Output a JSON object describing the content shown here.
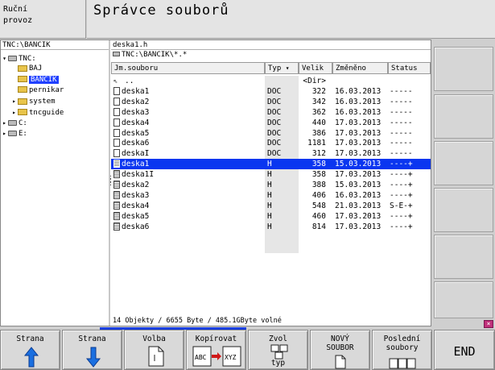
{
  "header": {
    "mode_line1": "Ruční",
    "mode_line2": "provoz",
    "title": "Správce souborů"
  },
  "tree": {
    "path": "TNC:\\BANCIK",
    "items": [
      {
        "label": "TNC:",
        "toggle": "▾",
        "icon": "drive-icon",
        "indent": 0
      },
      {
        "label": "BAJ",
        "toggle": "",
        "icon": "folder-icon",
        "indent": 1
      },
      {
        "label": "BANCIK",
        "toggle": "",
        "icon": "folder-icon",
        "indent": 1,
        "selected": true
      },
      {
        "label": "pernikar",
        "toggle": "",
        "icon": "folder-icon",
        "indent": 1
      },
      {
        "label": "system",
        "toggle": "▸",
        "icon": "folder-icon",
        "indent": 1
      },
      {
        "label": "tncguide",
        "toggle": "▸",
        "icon": "folder-icon",
        "indent": 1
      },
      {
        "label": "C:",
        "toggle": "▸",
        "icon": "drive-icon",
        "indent": 0
      },
      {
        "label": "E:",
        "toggle": "▸",
        "icon": "drive-icon",
        "indent": 0
      }
    ]
  },
  "files": {
    "selected_file": "deska1.h",
    "filter_path": "TNC:\\BANCIK\\*.*",
    "columns": {
      "name": "Jm.souboru",
      "type": "Typ",
      "type_arrow": "▾",
      "size": "Velik",
      "date": "Změněno",
      "status": "Status"
    },
    "rows": [
      {
        "name": "..",
        "type": "",
        "size": "<Dir>",
        "date": "",
        "status": "",
        "icon": "up-dir"
      },
      {
        "name": "deska1",
        "type": "DOC",
        "size": "322",
        "date": "16.03.2013",
        "status": "-----",
        "icon": "file"
      },
      {
        "name": "deska2",
        "type": "DOC",
        "size": "342",
        "date": "16.03.2013",
        "status": "-----",
        "icon": "file"
      },
      {
        "name": "deska3",
        "type": "DOC",
        "size": "362",
        "date": "16.03.2013",
        "status": "-----",
        "icon": "file"
      },
      {
        "name": "deska4",
        "type": "DOC",
        "size": "440",
        "date": "17.03.2013",
        "status": "-----",
        "icon": "file"
      },
      {
        "name": "deska5",
        "type": "DOC",
        "size": "386",
        "date": "17.03.2013",
        "status": "-----",
        "icon": "file"
      },
      {
        "name": "deska6",
        "type": "DOC",
        "size": "1181",
        "date": "17.03.2013",
        "status": "-----",
        "icon": "file"
      },
      {
        "name": "deskaI",
        "type": "DOC",
        "size": "312",
        "date": "17.03.2013",
        "status": "-----",
        "icon": "file"
      },
      {
        "name": "deska1",
        "type": "H",
        "size": "358",
        "date": "15.03.2013",
        "status": "----+",
        "icon": "hfile",
        "selected": true
      },
      {
        "name": "deska1I",
        "type": "H",
        "size": "358",
        "date": "17.03.2013",
        "status": "----+",
        "icon": "hfile"
      },
      {
        "name": "deska2",
        "type": "H",
        "size": "388",
        "date": "15.03.2013",
        "status": "----+",
        "icon": "hfile"
      },
      {
        "name": "deska3",
        "type": "H",
        "size": "406",
        "date": "16.03.2013",
        "status": "----+",
        "icon": "hfile"
      },
      {
        "name": "deska4",
        "type": "H",
        "size": "548",
        "date": "21.03.2013",
        "status": "S-E-+",
        "icon": "hfile"
      },
      {
        "name": "deska5",
        "type": "H",
        "size": "460",
        "date": "17.03.2013",
        "status": "----+",
        "icon": "hfile"
      },
      {
        "name": "deska6",
        "type": "H",
        "size": "814",
        "date": "17.03.2013",
        "status": "----+",
        "icon": "hfile"
      }
    ],
    "status_line": "14 Objekty / 6655 Byte / 485.1GByte volné"
  },
  "softkeys": [
    {
      "line1": "Strana",
      "line2": "",
      "icon": "arrow-up-icon"
    },
    {
      "line1": "Strana",
      "line2": "",
      "icon": "arrow-down-icon"
    },
    {
      "line1": "Volba",
      "line2": "",
      "icon": "select-file-icon"
    },
    {
      "line1": "Kopírovat",
      "line2": "",
      "icon": "copy-file-icon",
      "icon_from": "ABC",
      "icon_to": "XYZ"
    },
    {
      "line1": "Zvol",
      "line2": "typ",
      "icon": "choose-type-icon"
    },
    {
      "line1": "NOVÝ",
      "line2": "SOUBOR",
      "icon": "new-file-icon"
    },
    {
      "line1": "Poslední",
      "line2": "soubory",
      "icon": "recent-files-icon"
    },
    {
      "line1": "END",
      "line2": "",
      "icon": ""
    }
  ],
  "colors": {
    "selection": "#0a36f0",
    "folder": "#e8c44a",
    "accent_arrow": "#1a6fe0"
  }
}
